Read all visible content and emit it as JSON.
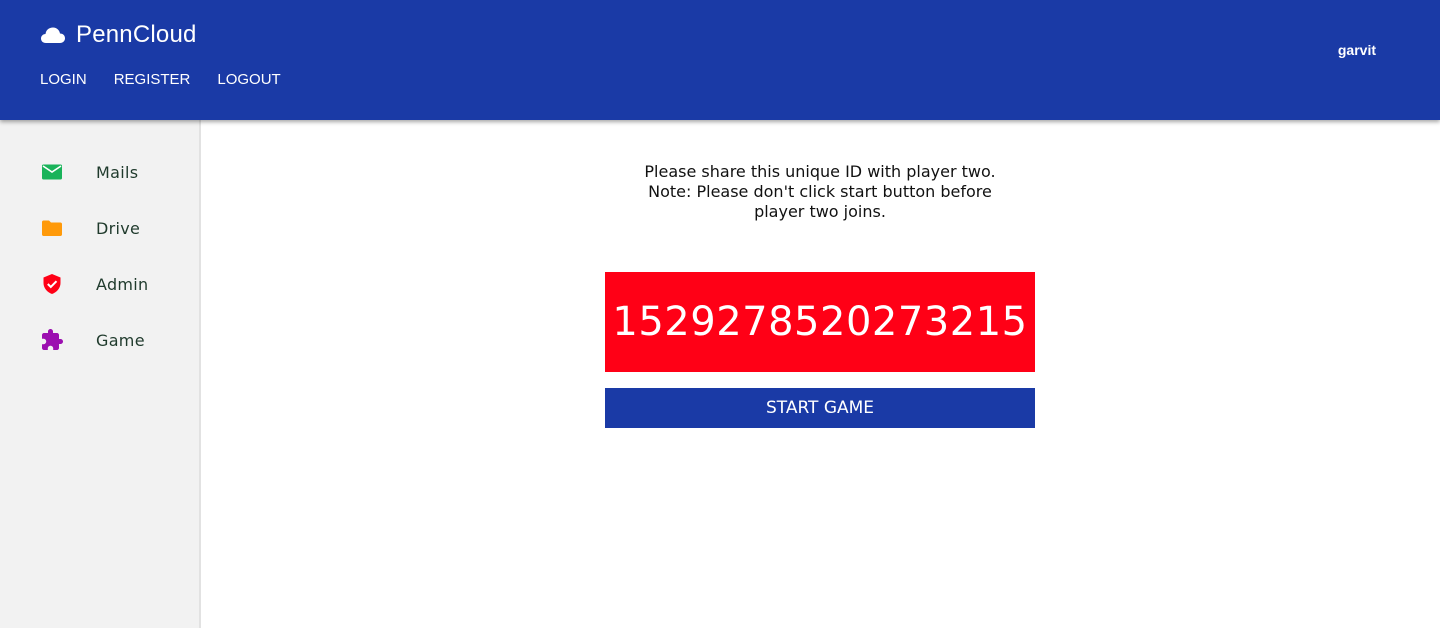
{
  "app": {
    "title": "PennCloud",
    "icon": "cloud-icon",
    "brand_color": "#1a3aa6"
  },
  "nav": {
    "items": [
      {
        "label": "LOGIN"
      },
      {
        "label": "REGISTER"
      },
      {
        "label": "LOGOUT"
      }
    ]
  },
  "user": {
    "name": "garvit"
  },
  "sidebar": {
    "items": [
      {
        "label": "Mails",
        "icon": "mail-icon",
        "color": "#19b35a"
      },
      {
        "label": "Drive",
        "icon": "folder-icon",
        "color": "#ff9a0a"
      },
      {
        "label": "Admin",
        "icon": "shield-check-icon",
        "color": "#ff0016"
      },
      {
        "label": "Game",
        "icon": "puzzle-icon",
        "color": "#9c0fb0"
      }
    ]
  },
  "game": {
    "message_line1": "Please share this unique ID with player two.",
    "message_line2": "Note: Please don't click start button before",
    "message_line3": "player two joins.",
    "unique_id": "1529278520273215",
    "id_color": "#ff0016",
    "start_label": "START GAME"
  }
}
